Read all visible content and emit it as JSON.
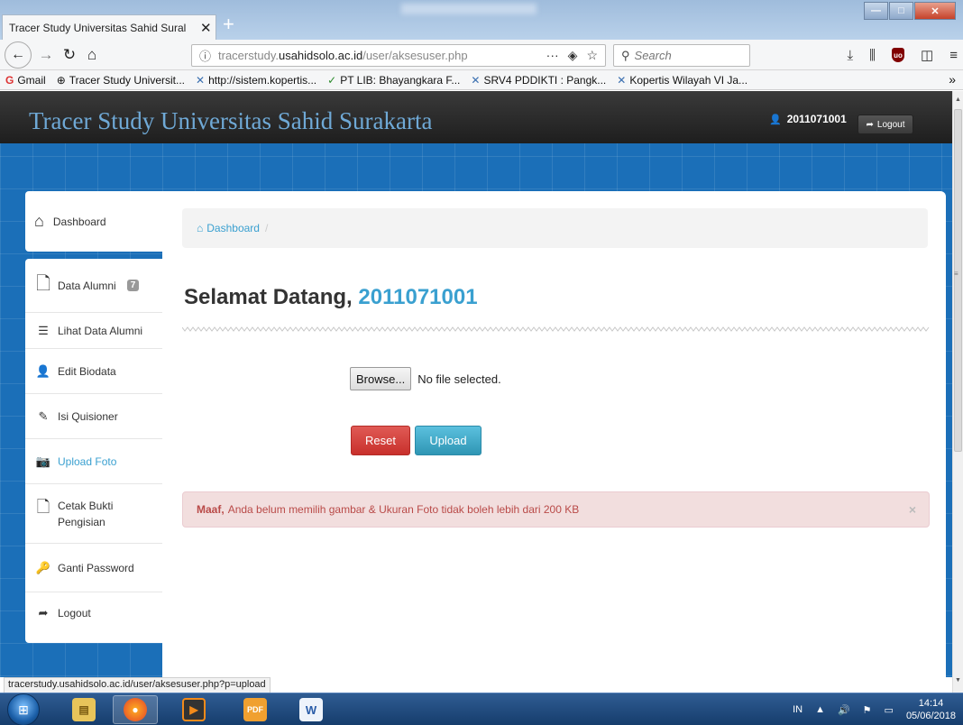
{
  "browser": {
    "tab_title": "Tracer Study Universitas Sahid Sural",
    "tab_close": "✕",
    "new_tab": "+",
    "url_prefix": "tracerstudy.",
    "url_domain": "usahidsolo.ac.id",
    "url_path": "/user/aksesuser.php",
    "url_more": "···",
    "search_placeholder": "Search",
    "window_controls": {
      "minimize": "—",
      "maximize": "□",
      "close": "✕"
    }
  },
  "bookmarks": [
    {
      "label": "Gmail",
      "icon": "G"
    },
    {
      "label": "Tracer Study Universit...",
      "icon": "⊕"
    },
    {
      "label": "http://sistem.kopertis...",
      "icon": "✕"
    },
    {
      "label": "PT LIB: Bhayangkara F...",
      "icon": "✓"
    },
    {
      "label": "SRV4 PDDIKTI : Pangk...",
      "icon": "✕"
    },
    {
      "label": "Kopertis Wilayah VI Ja...",
      "icon": "✕"
    }
  ],
  "bookmark_overflow": "»",
  "site": {
    "title": "Tracer Study Universitas Sahid Surakarta",
    "username": "2011071001",
    "logout_label": "Logout"
  },
  "sidebar": {
    "dashboard": "Dashboard",
    "items": [
      {
        "label": "Data Alumni",
        "badge": "7",
        "icon": "file-icon"
      },
      {
        "label": "Lihat Data Alumni",
        "icon": "list-icon"
      },
      {
        "label": "Edit Biodata",
        "icon": "user-icon"
      },
      {
        "label": "Isi Quisioner",
        "icon": "edit-icon"
      },
      {
        "label": "Upload Foto",
        "icon": "camera-icon",
        "active": true
      },
      {
        "label": "Cetak Bukti Pengisian",
        "icon": "document-icon"
      },
      {
        "label": "Ganti Password",
        "icon": "key-icon"
      },
      {
        "label": "Logout",
        "icon": "share-icon"
      }
    ]
  },
  "main": {
    "breadcrumb": "Dashboard",
    "breadcrumb_sep": "/",
    "welcome_prefix": "Selamat Datang,",
    "welcome_name": "2011071001",
    "browse_label": "Browse...",
    "file_status": "No file selected.",
    "reset_label": "Reset",
    "upload_label": "Upload",
    "alert_strong": "Maaf,",
    "alert_text": "Anda belum memilih gambar & Ukuran Foto tidak boleh lebih dari 200 KB",
    "alert_close": "×"
  },
  "status_url": "tracerstudy.usahidsolo.ac.id/user/aksesuser.php?p=upload",
  "taskbar": {
    "language": "IN",
    "time": "14:14",
    "date": "05/06/2018"
  },
  "colors": {
    "accent": "#3aa0d0",
    "danger": "#c8302c",
    "info": "#2f96b4",
    "alert_bg": "#f2dede",
    "alert_text": "#b94a48",
    "page_bg": "#1b6fb8",
    "header_bg": "#2a2a2a"
  }
}
